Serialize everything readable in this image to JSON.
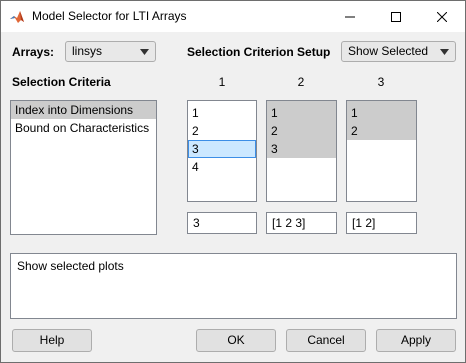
{
  "window": {
    "title": "Model Selector for LTI Arrays",
    "icon": "matlab-logo-icon"
  },
  "arrays": {
    "label": "Arrays:",
    "selected": "linsys"
  },
  "setup": {
    "label": "Selection Criterion Setup",
    "selected": "Show Selected"
  },
  "criteria": {
    "label": "Selection Criteria",
    "items": [
      "Index into Dimensions",
      "Bound on Characteristics"
    ],
    "selected_index": 0
  },
  "dimensions": [
    {
      "header": "1",
      "items": [
        "1",
        "2",
        "3",
        "4"
      ],
      "selected": [
        2
      ],
      "expression": "3"
    },
    {
      "header": "2",
      "items": [
        "1",
        "2",
        "3"
      ],
      "selected": [
        0,
        1,
        2
      ],
      "expression": "[1  2  3]"
    },
    {
      "header": "3",
      "items": [
        "1",
        "2"
      ],
      "selected": [
        0,
        1
      ],
      "expression": "[1  2]"
    }
  ],
  "status": {
    "text": "Show selected plots"
  },
  "buttons": {
    "help": "Help",
    "ok": "OK",
    "cancel": "Cancel",
    "apply": "Apply"
  }
}
